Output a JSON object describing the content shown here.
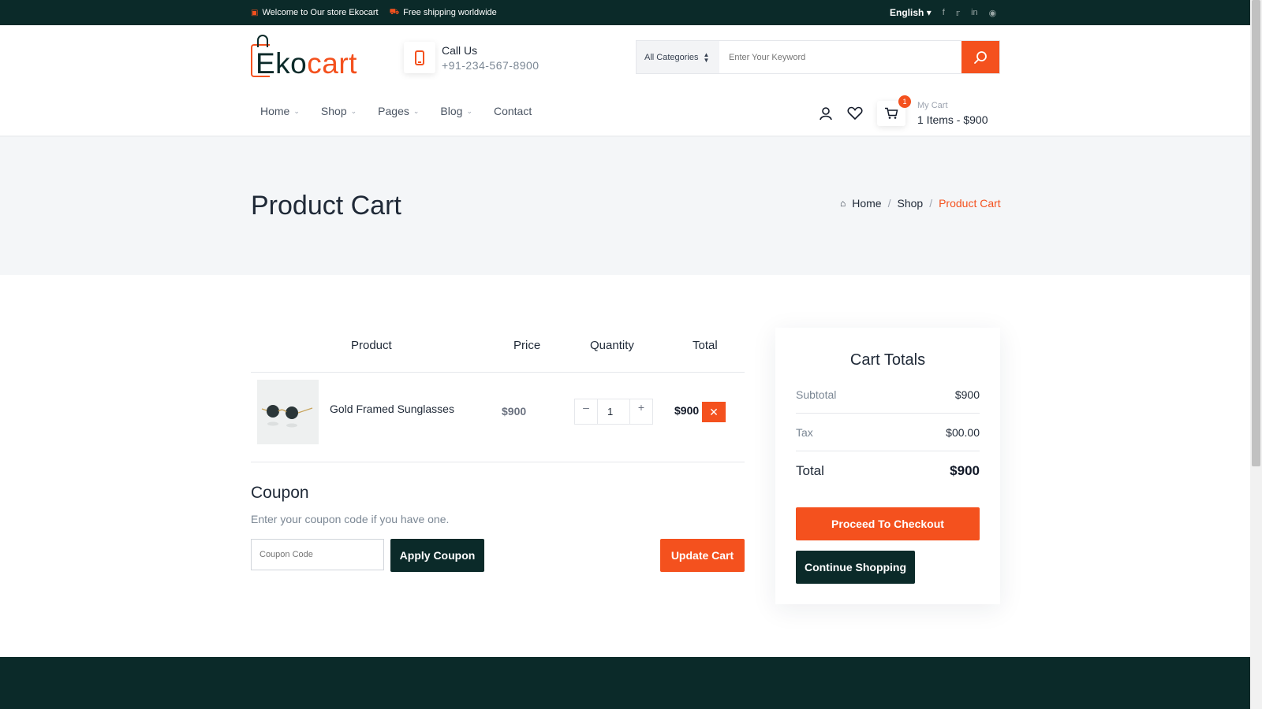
{
  "topbar": {
    "welcome": "Welcome to Our store Ekocart",
    "shipping": "Free shipping worldwide",
    "language": "English"
  },
  "header": {
    "logo_part1": "Eko",
    "logo_part2": "cart",
    "call_label": "Call Us",
    "phone": "+91-234-567-8900",
    "category": "All Categories",
    "search_placeholder": "Enter Your Keyword",
    "nav": [
      "Home",
      "Shop",
      "Pages",
      "Blog",
      "Contact"
    ],
    "cart_count": "1",
    "mycart_label": "My Cart",
    "mycart_summary": "1 Items - $900"
  },
  "banner": {
    "title": "Product Cart",
    "breadcrumb": [
      "Home",
      "Shop",
      "Product Cart"
    ]
  },
  "cart": {
    "columns": [
      "Product",
      "Price",
      "Quantity",
      "Total"
    ],
    "items": [
      {
        "name": "Gold Framed Sunglasses",
        "price": "$900",
        "quantity": "1",
        "total": "$900"
      }
    ]
  },
  "coupon": {
    "heading": "Coupon",
    "text": "Enter your coupon code if you have one.",
    "placeholder": "Coupon Code",
    "apply_label": "Apply Coupon",
    "update_label": "Update Cart"
  },
  "totals": {
    "heading": "Cart Totals",
    "subtotal_label": "Subtotal",
    "subtotal": "$900",
    "tax_label": "Tax",
    "tax": "$00.00",
    "total_label": "Total",
    "total": "$900",
    "checkout_label": "Proceed To Checkout",
    "continue_label": "Continue Shopping"
  },
  "colors": {
    "brand_orange": "#f4511e",
    "brand_dark": "#0b2a29"
  }
}
